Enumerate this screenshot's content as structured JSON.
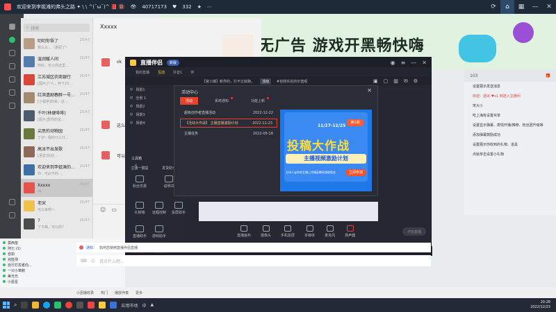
{
  "topbar": {
    "title": "欢迎来到李姐滩的弗头之路 ✦ \\ \\ ^(¯ω¯)^ 📕 🔞",
    "views": "40717173",
    "likes": "332",
    "icons": [
      "refresh-icon",
      "home-icon",
      "grid-icon",
      "minus-icon",
      "close-icon"
    ]
  },
  "banner": {
    "text": "无广告 游戏开黑畅快嗨"
  },
  "wechat": {
    "search_placeholder": "搜索",
    "chats": [
      {
        "name": "叨叨你悟了",
        "preview": "我么么…（委屈了）",
        "time": "20/47",
        "color": "#b79f87"
      },
      {
        "name": "温润暖人间",
        "preview": "你好，可以你这里…",
        "time": "20/47",
        "color": "#557cae"
      },
      {
        "name": "江苏城区农商银行",
        "preview": "[图片]个人，存下20…",
        "time": "20/47",
        "color": "#d8473a"
      },
      {
        "name": "红滨遗剧春醉一号…",
        "preview": "[小程序]快来，这…",
        "time": "20/47",
        "color": "#a38b70"
      },
      {
        "name": "千叶(林便啡啡)",
        "preview": "[图片]爱你的宝…",
        "time": "20/47",
        "color": "#4c5c6c"
      },
      {
        "name": "尖思的动物园",
        "preview": "丁卯：我的什么什…",
        "time": "20/47",
        "color": "#6a7a3e"
      },
      {
        "name": "高派不出发歌",
        "preview": "[语音]欢迎…",
        "time": "20/47",
        "color": "#8c6a56"
      },
      {
        "name": "欢迎来到李姐滩的…",
        "preview": "你：可必不的…",
        "time": "20/47",
        "color": "#3f6fa8"
      },
      {
        "name": "Xxxxx",
        "preview": "ok",
        "time": "20/47",
        "color": "#e5534b"
      },
      {
        "name": "老宋",
        "preview": "可以来啊～",
        "time": "20/47",
        "color": "#f1c24a"
      },
      {
        "name": "7",
        "preview": "了令峰，可以的？",
        "time": "20/47",
        "color": "#4d4d4d"
      }
    ]
  },
  "conv": {
    "title": "Xxxxx",
    "msg1": "ok",
    "msg2": "这么",
    "msg3": "可以"
  },
  "obs": {
    "brand": "直播伴侣",
    "brand_pill": "新版",
    "tabs": [
      "我的直播",
      "互动",
      "抖音1",
      "伴"
    ],
    "notice": [
      "【官小爆】新界的，打不过就跑。",
      "活动",
      "#自我实名的价值观"
    ],
    "scenes": [
      "场景1",
      "全景 1",
      "场景2",
      "场景3",
      "场景4"
    ],
    "tools_title": "工具箱",
    "tools": [
      "主播一键提",
      "发货助手",
      "粉丝优惠",
      "说明书",
      "礼物墙",
      "远程控制",
      "投屏助手",
      "直播助手",
      "游戏助手"
    ],
    "bottom_bar": [
      "直播画布",
      "摄像头",
      "手机投屏",
      "多媒体",
      "麦克风",
      "扬声器"
    ],
    "start_label": "开始直播",
    "status": "当前直播节目的直播间"
  },
  "dialog": {
    "title": "活动中心",
    "tabs": [
      "活动",
      "系统通知",
      "功能上新"
    ],
    "rows": [
      {
        "name": "超级创作者直播活动",
        "date": "2022-12-22"
      },
      {
        "name": "【活动大作战】 主播直播激励计划",
        "date": "2022-11-23"
      },
      {
        "name": "主播任务",
        "date": "2022-05-18"
      }
    ],
    "poster": {
      "date_range": "11/27-12/25",
      "badge": "第1期",
      "title": "投稿大作战",
      "subtitle": "主播视频激励计划",
      "note": "主持人@你的主播上传精彩瞬间领取现金",
      "button": "立即参加"
    }
  },
  "right_panel": {
    "count": "103",
    "msgs": [
      {
        "t": "设置展示发送消息",
        "red": false
      },
      {
        "t": "欢迎：送出 ♥x1 到送入主播间",
        "red": true
      },
      {
        "t": "宋大小",
        "red": false
      },
      {
        "t": "吃上海有设置买单",
        "red": false
      },
      {
        "t": "设置显示弹幕、表情开播/推荐、粉丝团升级等",
        "red": false
      },
      {
        "t": "添加弹幕鼓励成功",
        "red": false
      },
      {
        "t": "设置展示你收到的礼物、道具",
        "red": false
      },
      {
        "t": "点就单击设置小礼物",
        "red": false
      }
    ]
  },
  "left_list": {
    "items": [
      "莫西苗",
      "阿七 (1)",
      "自如",
      "完检测",
      "自行打扰者向...",
      "一只小笨鹅",
      "美光光",
      "小星星"
    ]
  },
  "comment": {
    "msg_user": "通知：",
    "msg_text": "如何您使用直播伴侣直播",
    "placeholder": "说点什么吧..."
  },
  "strip": [
    "小团播收录",
    "热门",
    "播放伴奏",
    "更多"
  ],
  "clock": {
    "time": "20:28",
    "date": "2022/12/23"
  },
  "tray": {
    "ime": "中",
    "label": "应用市场"
  }
}
